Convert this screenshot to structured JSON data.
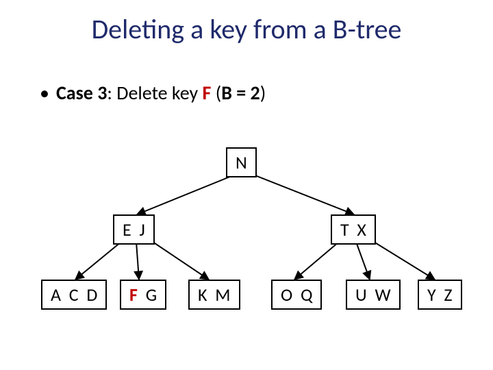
{
  "title": "Deleting a key from a B-tree",
  "bullet": {
    "case_prefix": "Case 3",
    "mid_text": ": Delete key ",
    "key": "F",
    "b_paren_open": "  (",
    "b_text": "B = 2",
    "b_paren_close": ")"
  },
  "tree": {
    "root": "N",
    "mid_left": "E  J",
    "mid_right": "T  X",
    "leaves": {
      "l1": "A  C  D",
      "l2_key": "F",
      "l2_rest": "  G",
      "l3": "K  M",
      "l4": "O  Q",
      "l5": "U  W",
      "l6": "Y  Z"
    }
  }
}
